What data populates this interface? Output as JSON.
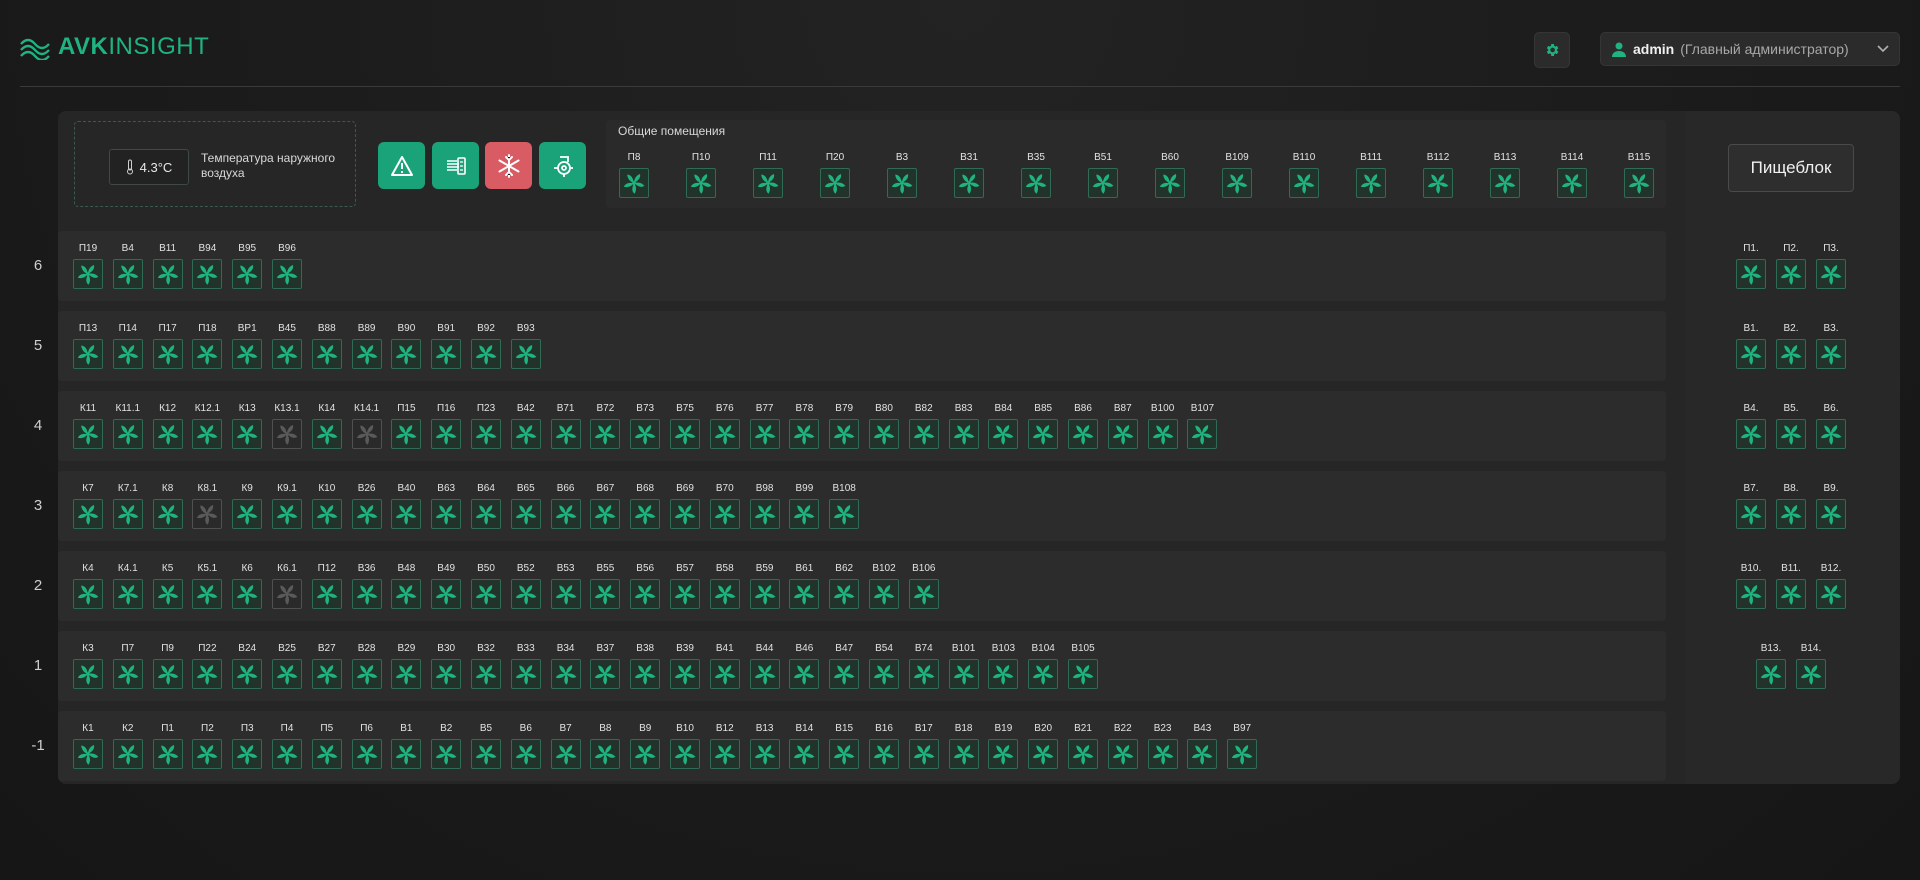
{
  "header": {
    "logo_bold": "AVK",
    "logo_rest": "INSIGHT",
    "user_name": "admin",
    "user_role": "(Главный администратор)"
  },
  "weather": {
    "temperature": "4.3°C",
    "label": "Температура наружного воздуха"
  },
  "actions": [
    {
      "name": "alarms-button",
      "icon": "warning-icon",
      "color": "green"
    },
    {
      "name": "ventilation-mode-button",
      "icon": "air-filter-icon",
      "color": "green"
    },
    {
      "name": "cooling-mode-button",
      "icon": "snowflake-icon",
      "color": "red"
    },
    {
      "name": "pump-button",
      "icon": "pump-icon",
      "color": "green"
    }
  ],
  "common": {
    "title": "Общие помещения",
    "units": [
      "П8",
      "П10",
      "П11",
      "П20",
      "В3",
      "В31",
      "В35",
      "В51",
      "В60",
      "В109",
      "В110",
      "В111",
      "В112",
      "В113",
      "В114",
      "В115"
    ]
  },
  "pishcheblok": {
    "button_label": "Пищеблок",
    "rows": [
      [
        "П1.",
        "П2.",
        "П3."
      ],
      [
        "В1.",
        "В2.",
        "В3."
      ],
      [
        "В4.",
        "В5.",
        "В6."
      ],
      [
        "В7.",
        "В8.",
        "В9."
      ],
      [
        "В10.",
        "В11.",
        "В12."
      ],
      [
        "В13.",
        "В14."
      ],
      []
    ]
  },
  "floors": [
    {
      "label": "6",
      "units": [
        "П19",
        "В4",
        "В11",
        "В94",
        "В95",
        "В96"
      ],
      "off": []
    },
    {
      "label": "5",
      "units": [
        "П13",
        "П14",
        "П17",
        "П18",
        "ВР1",
        "В45",
        "В88",
        "В89",
        "В90",
        "В91",
        "В92",
        "В93"
      ],
      "off": []
    },
    {
      "label": "4",
      "units": [
        "К11",
        "К11.1",
        "К12",
        "К12.1",
        "К13",
        "К13.1",
        "К14",
        "К14.1",
        "П15",
        "П16",
        "П23",
        "В42",
        "В71",
        "В72",
        "В73",
        "В75",
        "В76",
        "В77",
        "В78",
        "В79",
        "В80",
        "В82",
        "В83",
        "В84",
        "В85",
        "В86",
        "В87",
        "В100",
        "В107"
      ],
      "off": [
        "К13.1",
        "К14.1"
      ]
    },
    {
      "label": "3",
      "units": [
        "К7",
        "К7.1",
        "К8",
        "К8.1",
        "К9",
        "К9.1",
        "К10",
        "В26",
        "В40",
        "В63",
        "В64",
        "В65",
        "В66",
        "В67",
        "В68",
        "В69",
        "В70",
        "В98",
        "В99",
        "В108"
      ],
      "off": [
        "К8.1"
      ]
    },
    {
      "label": "2",
      "units": [
        "К4",
        "К4.1",
        "К5",
        "К5.1",
        "К6",
        "К6.1",
        "П12",
        "В36",
        "В48",
        "В49",
        "В50",
        "В52",
        "В53",
        "В55",
        "В56",
        "В57",
        "В58",
        "В59",
        "В61",
        "В62",
        "В102",
        "В106"
      ],
      "off": [
        "К6.1"
      ]
    },
    {
      "label": "1",
      "units": [
        "К3",
        "П7",
        "П9",
        "П22",
        "В24",
        "В25",
        "В27",
        "В28",
        "В29",
        "В30",
        "В32",
        "В33",
        "В34",
        "В37",
        "В38",
        "В39",
        "В41",
        "В44",
        "В46",
        "В47",
        "В54",
        "В74",
        "В101",
        "В103",
        "В104",
        "В105"
      ],
      "off": []
    },
    {
      "label": "-1",
      "units": [
        "К1",
        "К2",
        "П1",
        "П2",
        "П3",
        "П4",
        "П5",
        "П6",
        "В1",
        "В2",
        "В5",
        "В6",
        "В7",
        "В8",
        "В9",
        "В10",
        "В12",
        "В13",
        "В14",
        "В15",
        "В16",
        "В17",
        "В18",
        "В19",
        "В20",
        "В21",
        "В22",
        "В23",
        "В43",
        "В97"
      ],
      "off": []
    }
  ],
  "colors": {
    "accent": "#1fb37f",
    "fan_on": "#1fb37f",
    "fan_off": "#5a5a5a",
    "alert": "#d95c64"
  }
}
